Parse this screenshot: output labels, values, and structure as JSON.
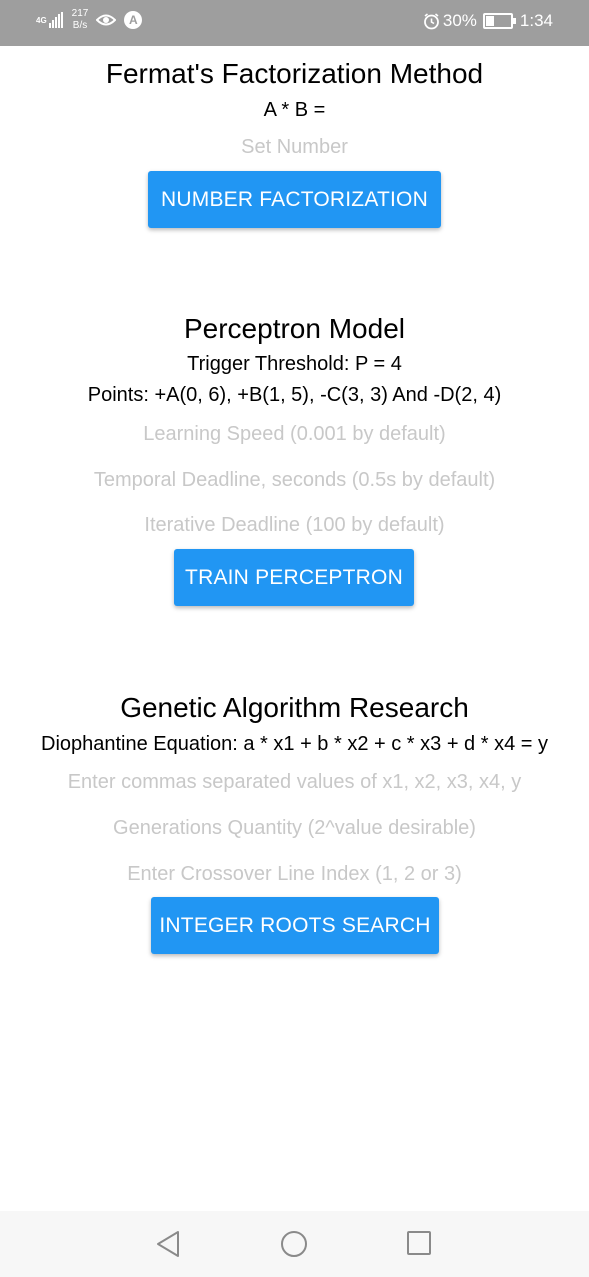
{
  "status_bar": {
    "network": "4G",
    "speed_value": "217",
    "speed_unit": "B/s",
    "battery": "30%",
    "battery_level": 0.3,
    "time": "1:34",
    "icons": [
      "signal-icon",
      "eye-icon",
      "app-a-icon",
      "alarm-icon",
      "battery-icon"
    ]
  },
  "fermat": {
    "title": "Fermat's Factorization Method",
    "formula": "A * B =",
    "input_placeholder": "Set Number",
    "button_label": "NUMBER FACTORIZATION"
  },
  "perceptron": {
    "title": "Perceptron Model",
    "threshold": "Trigger Threshold: P = 4",
    "points": "Points: +A(0, 6), +B(1, 5), -C(3, 3) And -D(2, 4)",
    "learning_speed_placeholder": "Learning Speed (0.001 by default)",
    "temporal_deadline_placeholder": "Temporal Deadline, seconds (0.5s by default)",
    "iterative_deadline_placeholder": "Iterative Deadline (100 by default)",
    "button_label": "TRAIN PERCEPTRON"
  },
  "genetic": {
    "title": "Genetic Algorithm Research",
    "equation": "Diophantine Equation: a * x1 + b * x2 + c * x3 + d * x4 = y",
    "values_placeholder": "Enter commas separated values of x1, x2, x3, x4, y",
    "generations_placeholder": "Generations Quantity (2^value desirable)",
    "crossover_placeholder": "Enter Crossover Line Index (1, 2 or 3)",
    "button_label": "INTEGER ROOTS SEARCH"
  },
  "colors": {
    "accent": "#2196f3",
    "status_bar": "#9e9e9e",
    "placeholder": "#c8c8c8",
    "nav_bar": "#f7f7f7"
  },
  "nav": [
    "back-icon",
    "home-icon",
    "recents-icon"
  ]
}
